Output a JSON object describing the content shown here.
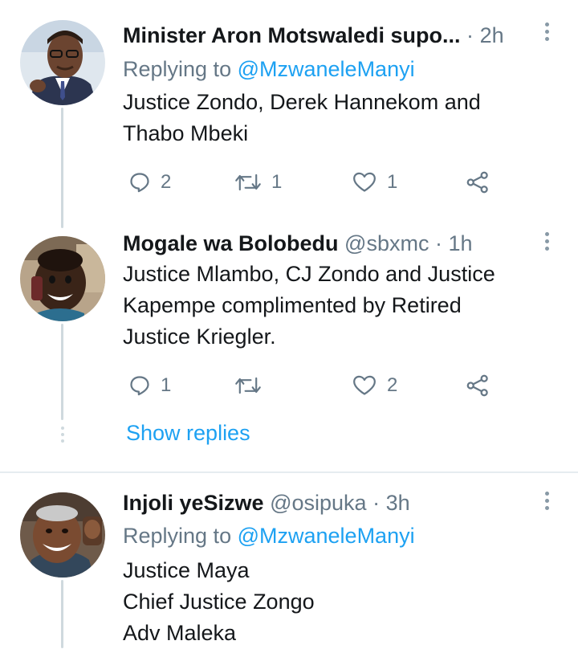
{
  "tweets": [
    {
      "name": "Minister Aron Motswaledi supo...",
      "separator": "·",
      "time": "2h",
      "replying_prefix": "Replying to",
      "replying_to": "@MzwaneleManyi",
      "lines": [
        "Justice Zondo, Derek Hannekom and",
        "Thabo Mbeki"
      ],
      "replies": "2",
      "retweets": "1",
      "likes": "1"
    },
    {
      "name": "Mogale wa Bolobedu",
      "handle": "@sbxmc",
      "separator": "·",
      "time": "1h",
      "lines": [
        "Justice Mlambo, CJ Zondo and Justice",
        "Kapempe complimented by Retired",
        "Justice Kriegler."
      ],
      "replies": "1",
      "retweets": "",
      "likes": "2",
      "show_replies": "Show replies"
    },
    {
      "name": "Injoli yeSizwe",
      "handle": "@osipuka",
      "separator": "·",
      "time": "3h",
      "replying_prefix": "Replying to",
      "replying_to": "@MzwaneleManyi",
      "lines": [
        "Justice Maya",
        "Chief Justice Zongo",
        "Adv Maleka"
      ]
    }
  ],
  "icons": {
    "reply": "reply-icon",
    "retweet": "retweet-icon",
    "like": "like-icon",
    "share": "share-icon",
    "more": "more-vertical-icon"
  },
  "colors": {
    "accent": "#1da1f2",
    "secondary_text": "#657786",
    "thread_line": "#cfd9de"
  }
}
